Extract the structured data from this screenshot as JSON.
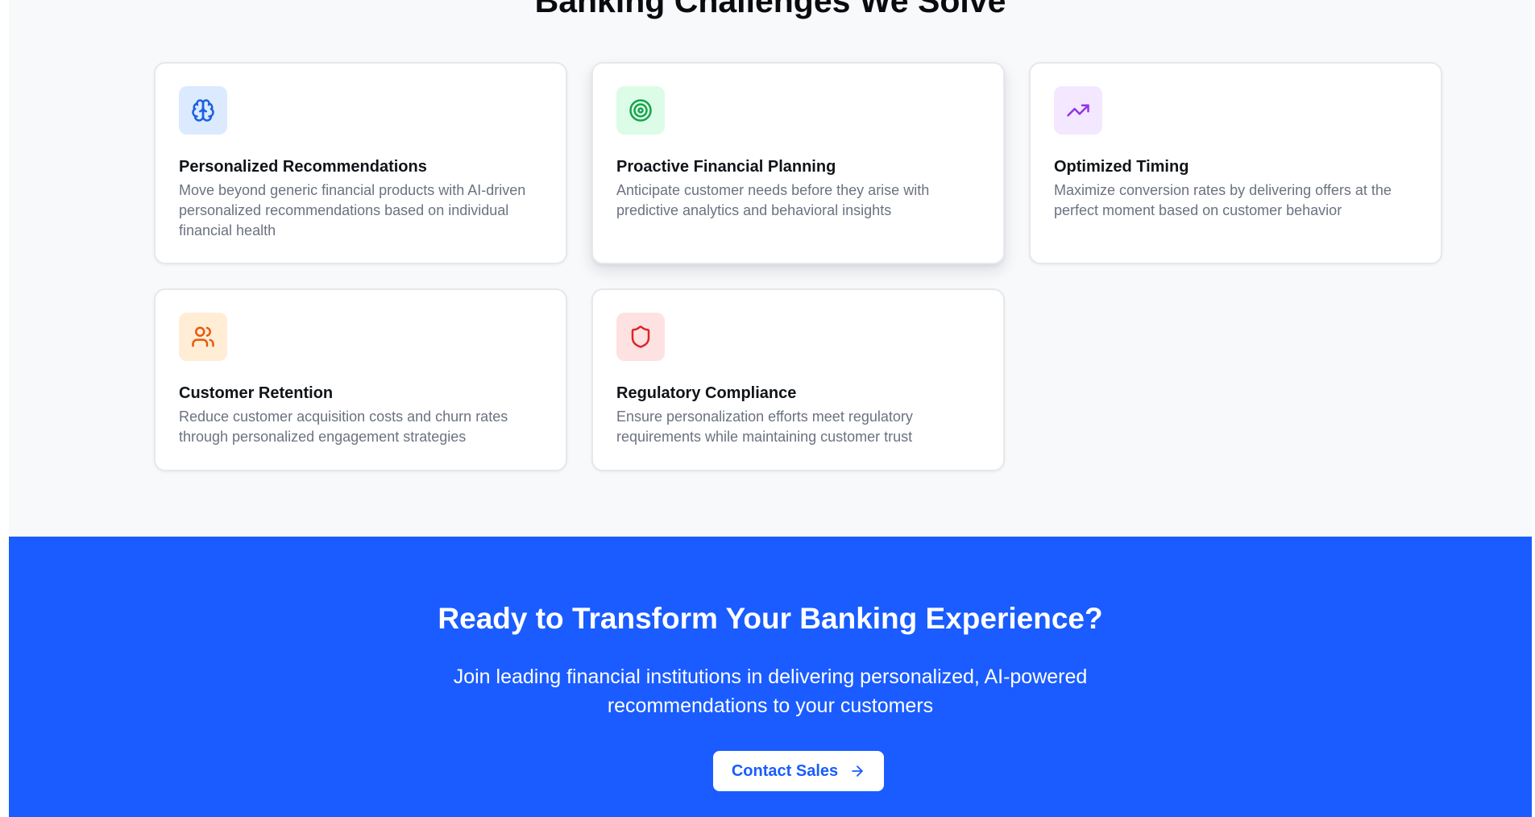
{
  "section": {
    "title": "Banking Challenges We Solve"
  },
  "cards": [
    {
      "icon": "brain-icon",
      "icon_bg": "#dbeafe",
      "icon_color": "#1d5fe0",
      "title": "Personalized Recommendations",
      "description": "Move beyond generic financial products with AI-driven personalized recommendations based on individual financial health"
    },
    {
      "icon": "target-icon",
      "icon_bg": "#dcfce7",
      "icon_color": "#16a34a",
      "title": "Proactive Financial Planning",
      "description": "Anticipate customer needs before they arise with predictive analytics and behavioral insights"
    },
    {
      "icon": "trending-up-icon",
      "icon_bg": "#f3e8ff",
      "icon_color": "#9333ea",
      "title": "Optimized Timing",
      "description": "Maximize conversion rates by delivering offers at the perfect moment based on customer behavior"
    },
    {
      "icon": "users-icon",
      "icon_bg": "#ffedd5",
      "icon_color": "#ea580c",
      "title": "Customer Retention",
      "description": "Reduce customer acquisition costs and churn rates through personalized engagement strategies"
    },
    {
      "icon": "shield-icon",
      "icon_bg": "#fee2e2",
      "icon_color": "#dc2626",
      "title": "Regulatory Compliance",
      "description": "Ensure personalization efforts meet regulatory requirements while maintaining customer trust"
    }
  ],
  "cta": {
    "title": "Ready to Transform Your Banking Experience?",
    "subtitle": "Join leading financial institutions in delivering personalized, AI-powered recommendations to your customers",
    "button_label": "Contact Sales",
    "button_icon": "arrow-right-icon",
    "background": "#1a5cff"
  }
}
